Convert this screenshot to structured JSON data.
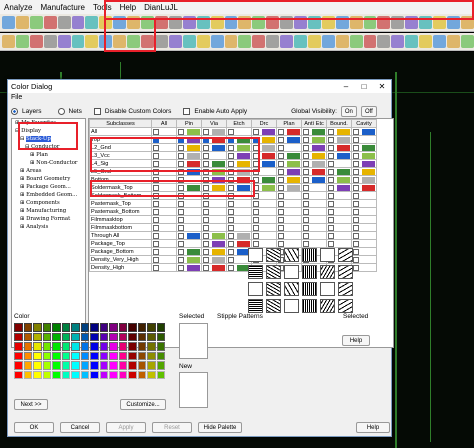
{
  "menu": {
    "items": [
      "Analyze",
      "Manufacture",
      "Tools",
      "Help",
      "DianLuJL"
    ]
  },
  "dialog": {
    "title": "Color Dialog",
    "file_menu": "File",
    "radios": {
      "layers": "Layers",
      "nets": "Nets"
    },
    "options": {
      "disable_custom": "Disable Custom Colors",
      "auto_apply": "Enable Auto Apply"
    },
    "visibility": {
      "label": "Global Visibility:",
      "on": "On",
      "off": "Off"
    },
    "tree": [
      "My Favorites",
      "Display",
      "Stack-Up",
      "Conductor",
      "Plan",
      "Non-Conductor",
      "Areas",
      "Board Geometry",
      "Package Geom...",
      "Embedded Geom...",
      "Components",
      "Manufacturing",
      "Drawing Format",
      "Analysis"
    ],
    "columns": [
      "Subclasses",
      "All",
      "Pin",
      "Via",
      "Etch",
      "Drc",
      "Plan",
      "Antì Etc",
      "Bound.",
      "Cavity"
    ],
    "rows": [
      "All",
      "Top",
      "L2_Gnd",
      "L3_Vcc",
      "L4_Sig",
      "L5_Gnd",
      "Bottom",
      "Soldermask_Top",
      "Soldermask_Bottom",
      "Pastemask_Top",
      "Pastemask_Bottom",
      "Filmmasktop",
      "Filmmaskbottom",
      "Through All",
      "Package_Top",
      "Package_Bottom",
      "Density_Very_High",
      "Density_High"
    ],
    "color_label": "Color",
    "selected_label": "Selected",
    "new_label": "New",
    "stipple_label": "Stipple Patterns",
    "selected2_label": "Selected",
    "help": "Help",
    "next": "Next >>",
    "customize": "Customize...",
    "footer": [
      "OK",
      "Cancel",
      "Apply",
      "Reset",
      "Hide Palette",
      "Help"
    ]
  },
  "colors": {
    "accent": "#1b5fc9",
    "highlight": "#e8202a"
  }
}
